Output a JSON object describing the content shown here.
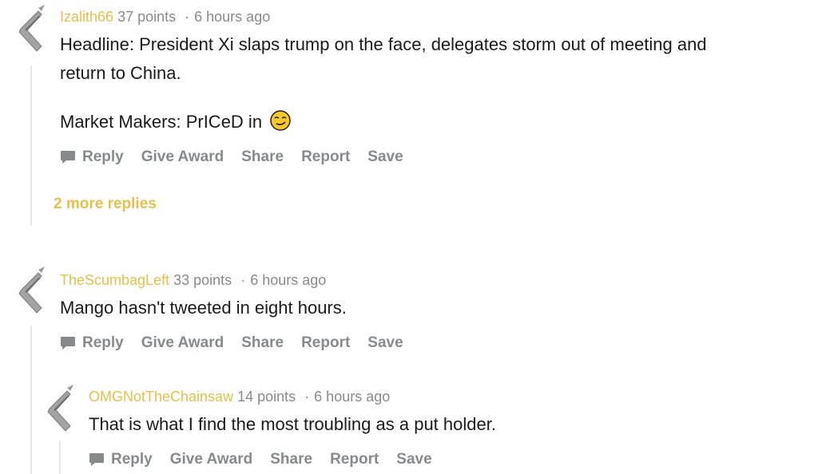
{
  "comments": [
    {
      "author": "Izalith66",
      "points": "37 points",
      "separator": "·",
      "time": "6 hours ago",
      "body_line1": "Headline: President Xi slaps trump on the face, delegates storm out of meeting and",
      "body_line2": "return to China.",
      "body_line3": "Market Makers: PrICeD in",
      "emoji": "smirk-emoji",
      "more_replies": "2 more replies"
    },
    {
      "author": "TheScumbagLeft",
      "points": "33 points",
      "separator": "·",
      "time": "6 hours ago",
      "body_line1": "Mango hasn't tweeted in eight hours."
    },
    {
      "author": "OMGNotTheChainsaw",
      "points": "14 points",
      "separator": "·",
      "time": "6 hours ago",
      "body_line1": "That is what I find the most troubling as a put holder."
    }
  ],
  "actions": {
    "reply": "Reply",
    "give_award": "Give Award",
    "share": "Share",
    "report": "Report",
    "save": "Save"
  },
  "icons": {
    "reply": "comment-bubble-icon",
    "avatar": "snoo-avatar-icon"
  },
  "colors": {
    "author": "#e5c04a",
    "meta": "#8a8a8a",
    "body": "#1a1a1b",
    "actions": "#878a8c"
  }
}
